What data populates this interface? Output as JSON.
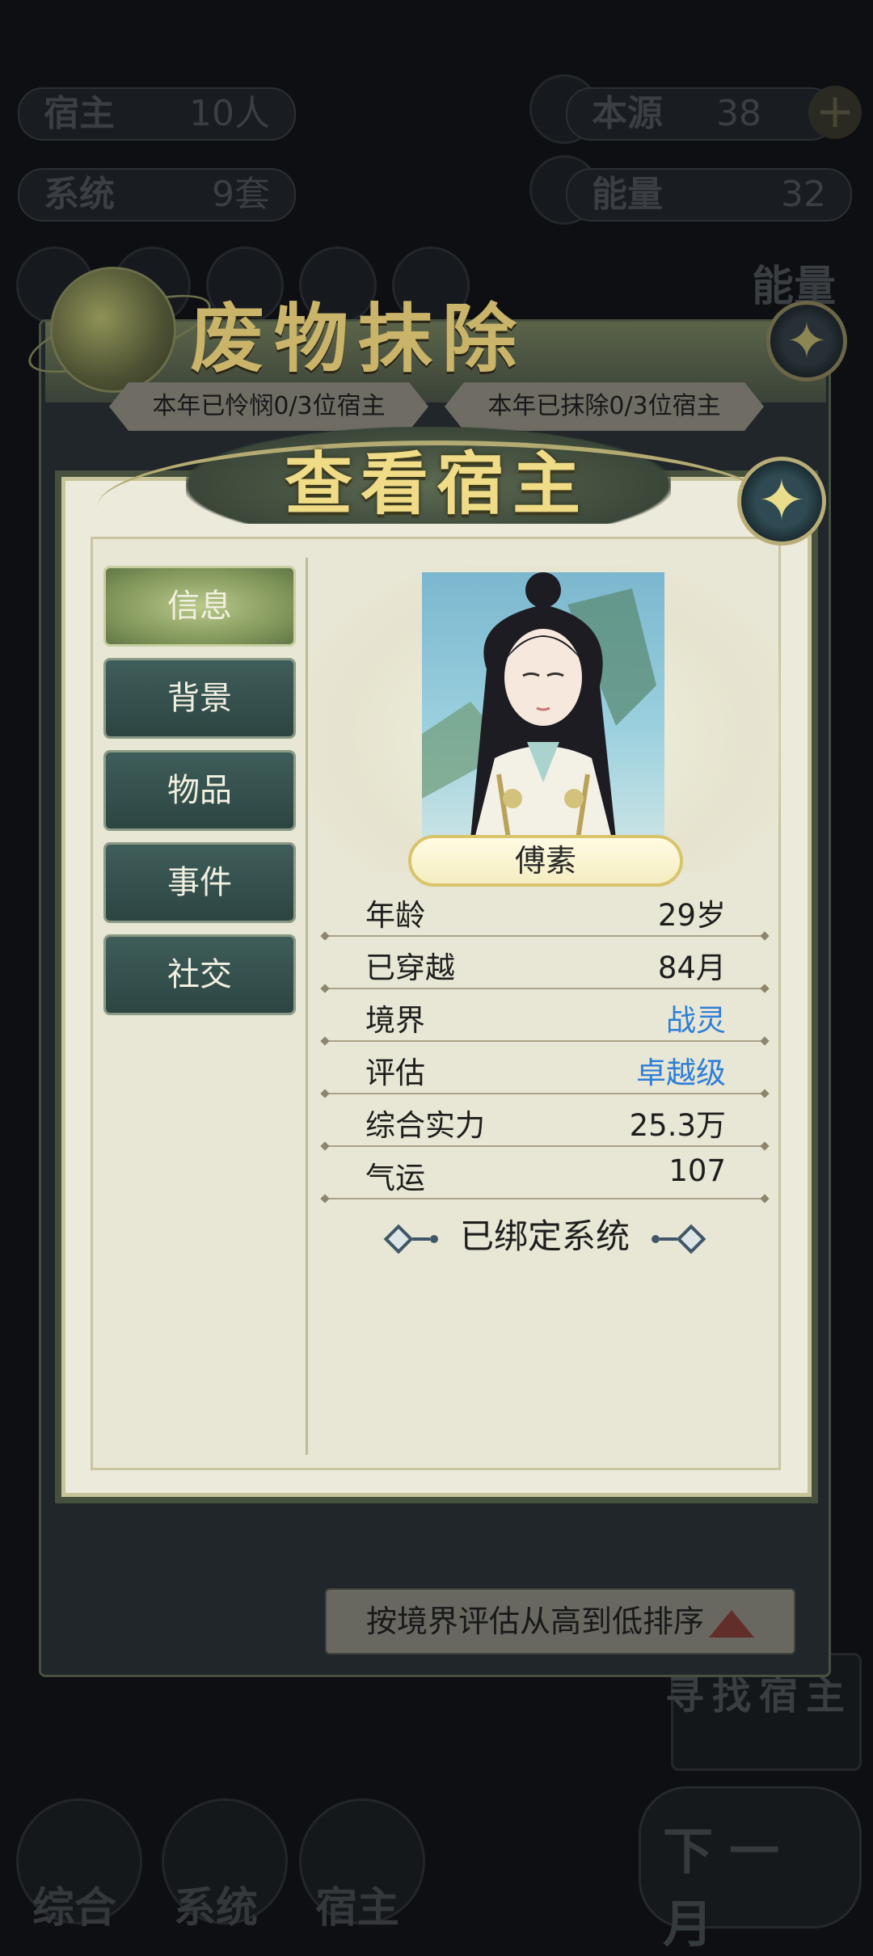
{
  "hud": {
    "host_label": "宿主",
    "host_value": "10人",
    "system_label": "系统",
    "system_value": "9套",
    "origin_label": "本源",
    "origin_value": "38",
    "energy_label": "能量",
    "energy_value": "32",
    "energy_side_label": "能量"
  },
  "bottom_nav": {
    "overview": "综合",
    "system": "系统",
    "host": "宿主",
    "next_month": "下一月",
    "find_host": "寻找宿主"
  },
  "waste_dialog": {
    "title": "废物抹除",
    "pitied_chip": "本年已怜悯0/3位宿主",
    "erased_chip": "本年已抹除0/3位宿主",
    "sort_label": "按境界评估从高到低排序"
  },
  "host_dialog": {
    "title": "查看宿主",
    "tabs": [
      {
        "label": "信息",
        "active": true
      },
      {
        "label": "背景",
        "active": false
      },
      {
        "label": "物品",
        "active": false
      },
      {
        "label": "事件",
        "active": false
      },
      {
        "label": "社交",
        "active": false
      }
    ],
    "name": "傅素",
    "stats": [
      {
        "label": "年龄",
        "value": "29岁",
        "highlight": false
      },
      {
        "label": "已穿越",
        "value": "84月",
        "highlight": false
      },
      {
        "label": "境界",
        "value": "战灵",
        "highlight": true
      },
      {
        "label": "评估",
        "value": "卓越级",
        "highlight": true
      },
      {
        "label": "综合实力",
        "value": "25.3万",
        "highlight": false
      },
      {
        "label": "气运",
        "value": "107",
        "highlight": false
      }
    ],
    "bound_systems_title": "已绑定系统"
  },
  "colors": {
    "highlight_value": "#2d7fd8",
    "active_tab": "#9db26e",
    "inactive_tab": "#345250",
    "title_gold": "#f0dc86"
  },
  "icons": {
    "close": "close-star-icon",
    "plus": "plus-icon",
    "sort_direction": "sort-up-triangle-icon"
  }
}
